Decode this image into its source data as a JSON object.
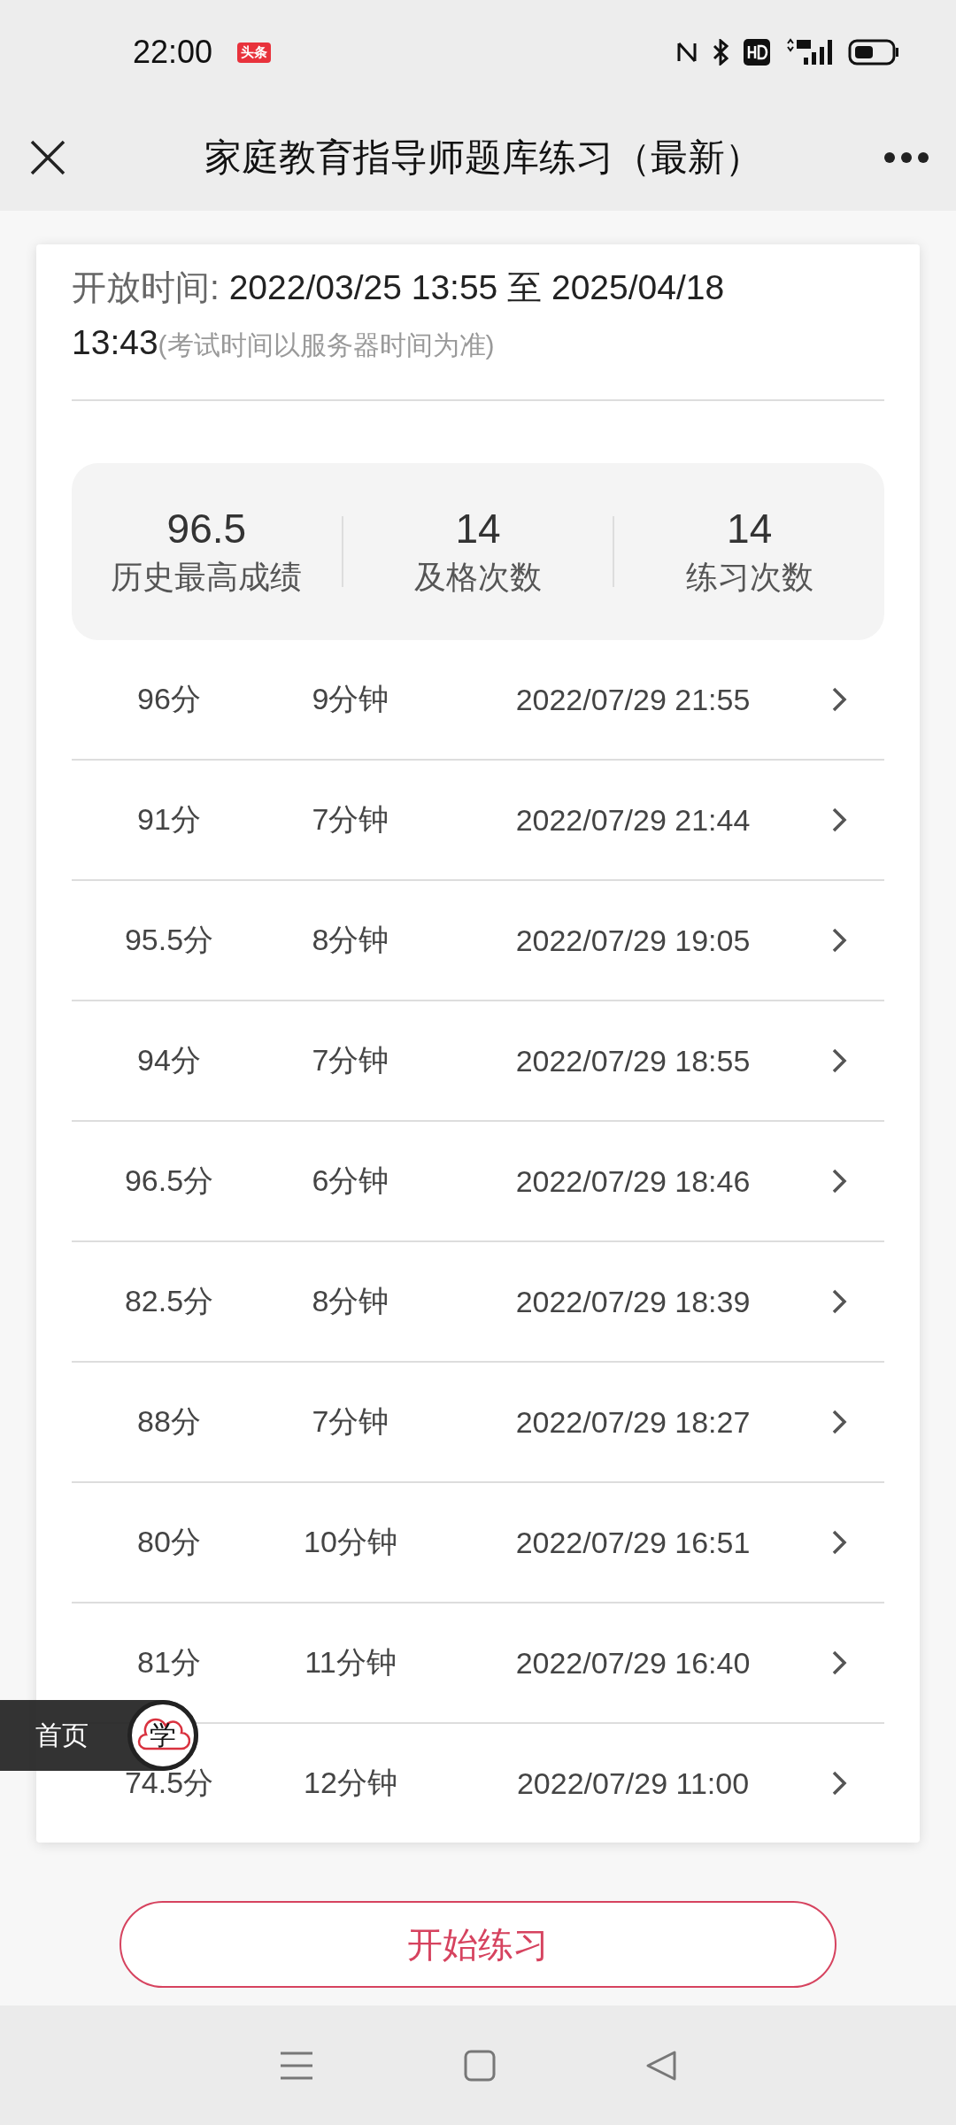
{
  "status_bar": {
    "time": "22:00",
    "notification_badge": "头条"
  },
  "header": {
    "title": "家庭教育指导师题库练习（最新）"
  },
  "open_time": {
    "label": "开放时间:",
    "range": "2022/03/25 13:55 至 2025/04/18 13:43",
    "note": "(考试时间以服务器时间为准)"
  },
  "stats": [
    {
      "value": "96.5",
      "label": "历史最高成绩"
    },
    {
      "value": "14",
      "label": "及格次数"
    },
    {
      "value": "14",
      "label": "练习次数"
    }
  ],
  "records": [
    {
      "score": "96分",
      "duration": "9分钟",
      "time": "2022/07/29 21:55"
    },
    {
      "score": "91分",
      "duration": "7分钟",
      "time": "2022/07/29 21:44"
    },
    {
      "score": "95.5分",
      "duration": "8分钟",
      "time": "2022/07/29 19:05"
    },
    {
      "score": "94分",
      "duration": "7分钟",
      "time": "2022/07/29 18:55"
    },
    {
      "score": "96.5分",
      "duration": "6分钟",
      "time": "2022/07/29 18:46"
    },
    {
      "score": "82.5分",
      "duration": "8分钟",
      "time": "2022/07/29 18:39"
    },
    {
      "score": "88分",
      "duration": "7分钟",
      "time": "2022/07/29 18:27"
    },
    {
      "score": "80分",
      "duration": "10分钟",
      "time": "2022/07/29 16:51"
    },
    {
      "score": "81分",
      "duration": "11分钟",
      "time": "2022/07/29 16:40"
    },
    {
      "score": "74.5分",
      "duration": "12分钟",
      "time": "2022/07/29 11:00"
    }
  ],
  "start_button": {
    "label": "开始练习"
  },
  "floating_home": {
    "label": "首页",
    "logo_text": "学"
  }
}
